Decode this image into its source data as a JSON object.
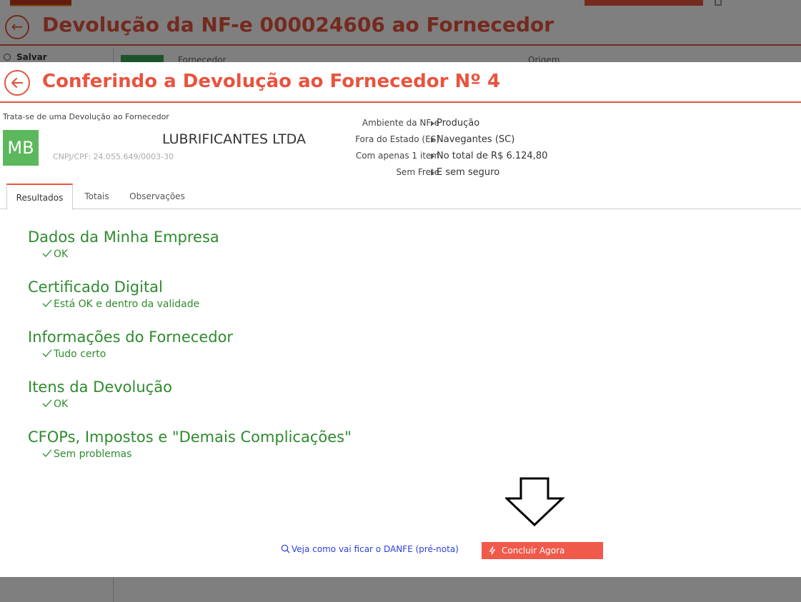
{
  "background": {
    "title": "Devolução da NF-e 000024606 ao Fornecedor",
    "save_label": "Salvar",
    "fornecedor_label": "Fornecedor",
    "origem_label": "Origem"
  },
  "modal": {
    "title": "Conferindo a Devolução ao Fornecedor Nº 4",
    "subtitle": "Trata-se de uma Devolução ao Fornecedor",
    "avatar_initials": "MB",
    "company_name": "LUBRIFICANTES LTDA",
    "cnpj": "CNPJ/CPF: 24.055.649/0003-30",
    "info": [
      {
        "key": "Ambiente da NF-e",
        "value": "Produção"
      },
      {
        "key": "Fora do Estado (ES)",
        "value": "Navegantes (SC)"
      },
      {
        "key": "Com apenas 1 item",
        "value": "No total de R$ 6.124,80"
      },
      {
        "key": "Sem Frete",
        "value": "E sem seguro"
      }
    ],
    "tabs": [
      "Resultados",
      "Totais",
      "Observações"
    ],
    "active_tab": "Resultados",
    "results": [
      {
        "title": "Dados da Minha Empresa",
        "status": "OK"
      },
      {
        "title": "Certificado Digital",
        "status": "Está OK e dentro da validade"
      },
      {
        "title": "Informações do Fornecedor",
        "status": "Tudo certo"
      },
      {
        "title": "Itens da Devolução",
        "status": "OK"
      },
      {
        "title": "CFOPs, Impostos e \"Demais Complicações\"",
        "status": "Sem problemas"
      }
    ],
    "danfe_link": "Veja como vai ficar o DANFE (pré-nota)",
    "concluir_button": "Concluir Agora"
  },
  "colors": {
    "accent": "#e8543f",
    "success": "#2e8b2e",
    "avatar_bg": "#5cb85c",
    "link": "#2c3edb",
    "button_bg": "#f05a4b"
  }
}
